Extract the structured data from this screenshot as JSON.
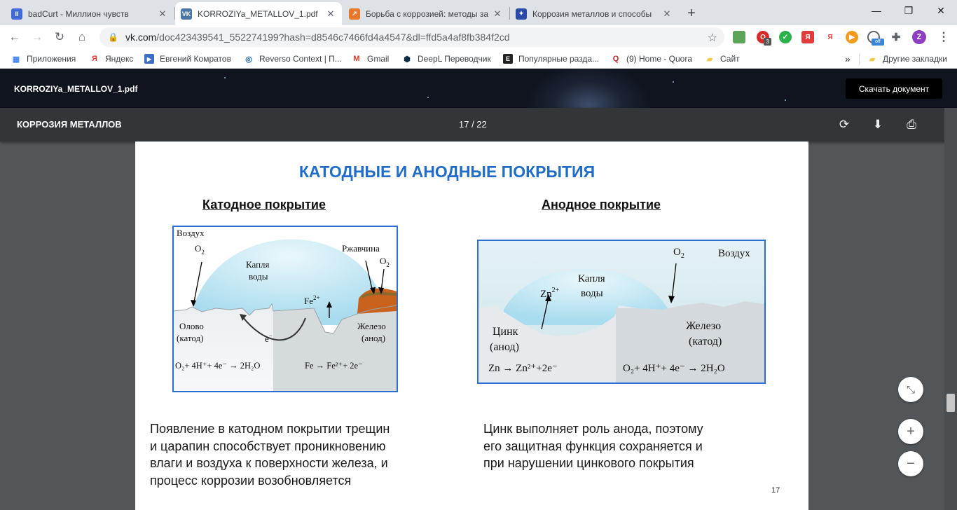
{
  "browser": {
    "tabs": [
      {
        "title": "badCurt - Миллион чувств",
        "color": "#3f6ad8",
        "glyph": "II"
      },
      {
        "title": "KORROZIYa_METALLOV_1.pdf",
        "color": "#4a76a8",
        "glyph": "VK"
      },
      {
        "title": "Борьба с коррозией: методы за",
        "color": "#e8762b",
        "glyph": "↗"
      },
      {
        "title": "Коррозия металлов и способы",
        "color": "#2b49a8",
        "glyph": "✦"
      }
    ],
    "url_host": "vk.com",
    "url_rest": "/doc423439541_552274199?hash=d8546c7466fd4a4547&dl=ffd5a4af8fb384f2cd",
    "bookmarks": [
      "Приложения",
      "Яндекс",
      "Евгений Комратов",
      "Reverso Context | П...",
      "Gmail",
      "DeepL Переводчик",
      "Популярные разда...",
      "(9) Home - Quora",
      "Сайт"
    ],
    "other_bookmarks": "Другие закладки",
    "more_bookmarks": "»",
    "ext_badge": "3",
    "ext_off": "off",
    "profile_letter": "Z"
  },
  "doc": {
    "filename": "KORROZIYa_METALLOV_1.pdf",
    "download_label": "Скачать документ"
  },
  "pdf": {
    "title": "КОРРОЗИЯ МЕТАЛЛОВ",
    "page_indicator": "17 / 22"
  },
  "slide": {
    "title": "КАТОДНЫЕ И АНОДНЫЕ ПОКРЫТИЯ",
    "left_heading": "Катодное покрытие",
    "right_heading": "Анодное покрытие",
    "left_text": [
      "Появление в катодном покрытии трещин",
      "и царапин способствует проникновению",
      "влаги и воздуха к поверхности железа, и",
      "процесс коррозии возобновляется"
    ],
    "right_text": [
      "Цинк выполняет роль анода, поэтому",
      "его защитная функция сохраняется и",
      "при нарушении цинкового покрытия"
    ],
    "page_number": "17"
  },
  "fig_left": {
    "air": "Воздух",
    "o2": "O",
    "o2_sub": "2",
    "drop1": "Капля",
    "drop2": "воды",
    "rust": "Ржавчина",
    "fe": "Fe",
    "fe_sup": "2+",
    "tin1": "Олово",
    "tin2": "(катод)",
    "iron1": "Железо",
    "iron2": "(анод)",
    "electron": "e",
    "electron_sup": "−",
    "eq_left": "O₂+ 4H⁺+ 4e⁻ → 2H₂O",
    "eq_right": "Fe → Fe²⁺+ 2e⁻"
  },
  "fig_right": {
    "air": "Воздух",
    "o2": "O",
    "o2_sub": "2",
    "zn": "Zn",
    "zn_sup": "2+",
    "drop1": "Капля",
    "drop2": "воды",
    "zinc1": "Цинк",
    "zinc2": "(анод)",
    "iron1": "Железо",
    "iron2": "(катод)",
    "eq_left": "Zn → Zn²⁺+2e⁻",
    "eq_right": "O₂+ 4H⁺+ 4e⁻ → 2H₂O"
  }
}
